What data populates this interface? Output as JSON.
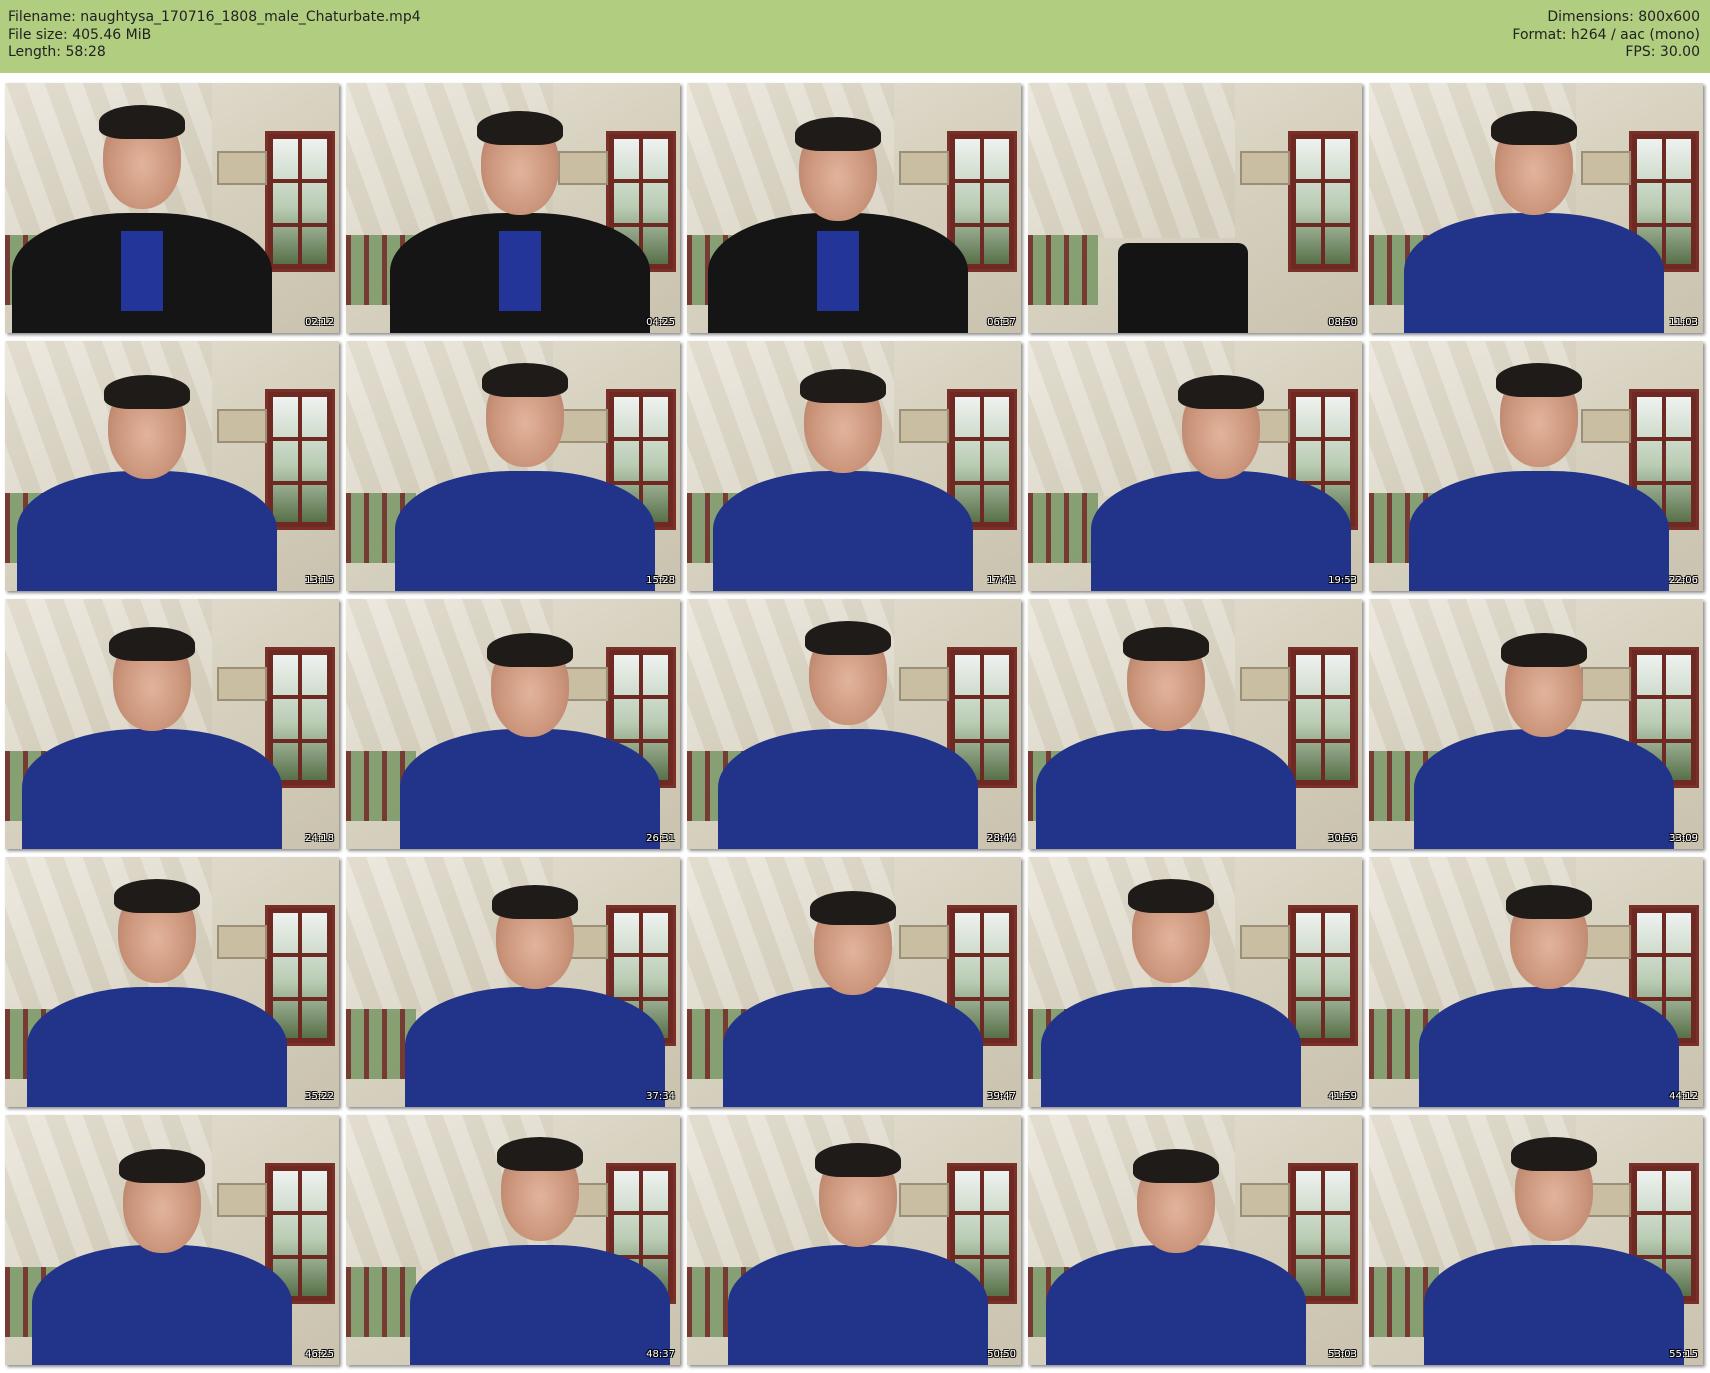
{
  "header": {
    "filename": "Filename: naughtysa_170716_1808_male_Chaturbate.mp4",
    "filesize": "File size: 405.46 MiB",
    "length": "Length: 58:28",
    "dimensions": "Dimensions: 800x600",
    "format": "Format: h264 / aac (mono)",
    "fps": "FPS: 30.00"
  },
  "thumbnails": [
    {
      "time": "02:12",
      "scene": "jacket"
    },
    {
      "time": "04:25",
      "scene": "jacket"
    },
    {
      "time": "06:37",
      "scene": "jacket"
    },
    {
      "time": "08:50",
      "scene": "empty-chair"
    },
    {
      "time": "11:03",
      "scene": "tshirt"
    },
    {
      "time": "13:15",
      "scene": "tshirt"
    },
    {
      "time": "15:28",
      "scene": "tshirt"
    },
    {
      "time": "17:41",
      "scene": "tshirt"
    },
    {
      "time": "19:53",
      "scene": "tshirt"
    },
    {
      "time": "22:06",
      "scene": "tshirt"
    },
    {
      "time": "24:18",
      "scene": "tshirt"
    },
    {
      "time": "26:31",
      "scene": "tshirt"
    },
    {
      "time": "28:44",
      "scene": "tshirt"
    },
    {
      "time": "30:56",
      "scene": "tshirt"
    },
    {
      "time": "33:09",
      "scene": "tshirt"
    },
    {
      "time": "35:22",
      "scene": "tshirt"
    },
    {
      "time": "37:34",
      "scene": "tshirt"
    },
    {
      "time": "39:47",
      "scene": "tshirt"
    },
    {
      "time": "41:59",
      "scene": "tshirt"
    },
    {
      "time": "44:12",
      "scene": "tshirt"
    },
    {
      "time": "46:25",
      "scene": "tshirt"
    },
    {
      "time": "48:37",
      "scene": "tshirt"
    },
    {
      "time": "50:50",
      "scene": "tshirt"
    },
    {
      "time": "53:03",
      "scene": "tshirt"
    },
    {
      "time": "55:15",
      "scene": "tshirt"
    }
  ]
}
